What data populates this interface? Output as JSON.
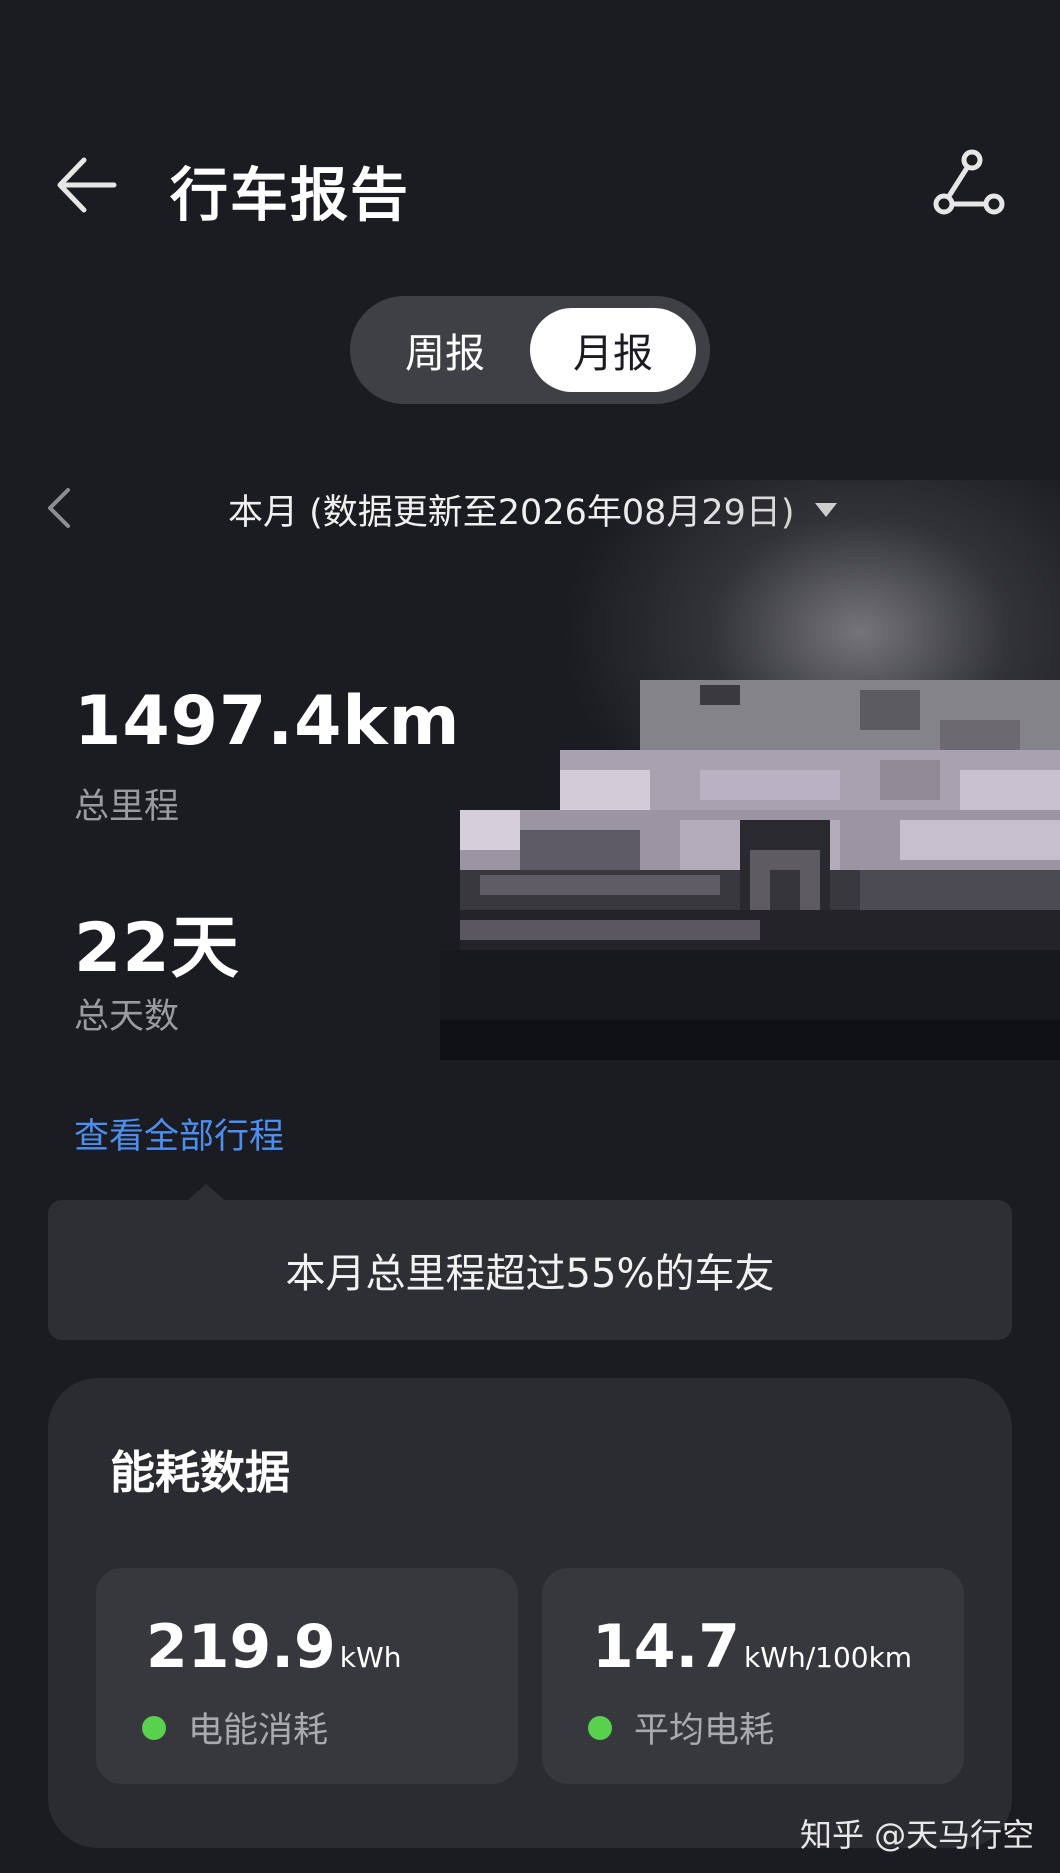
{
  "header": {
    "title": "行车报告",
    "back_icon": "arrow-left-icon",
    "share_icon": "share-icon"
  },
  "report_tabs": {
    "week_label": "周报",
    "month_label": "月报",
    "selected": "月报"
  },
  "period": {
    "text": "本月 (数据更新至2026年08月29日)",
    "prev_icon": "chevron-left-icon",
    "dropdown_icon": "caret-down-icon"
  },
  "stats": {
    "mileage_value": "1497.4km",
    "mileage_label": "总里程",
    "days_value": "22天",
    "days_label": "总天数",
    "view_all_label": "查看全部行程"
  },
  "ranking": {
    "text": "本月总里程超过55%的车友"
  },
  "energy": {
    "title": "能耗数据",
    "consumption": {
      "value": "219.9",
      "unit": "kWh",
      "label": "电能消耗"
    },
    "average": {
      "value": "14.7",
      "unit": "kWh/100km",
      "label": "平均电耗"
    }
  },
  "watermark": "知乎 @天马行空",
  "colors": {
    "background": "#1b1c21",
    "link": "#4d8ff0",
    "status_dot": "#58d14c",
    "card": "#2b2c31"
  }
}
